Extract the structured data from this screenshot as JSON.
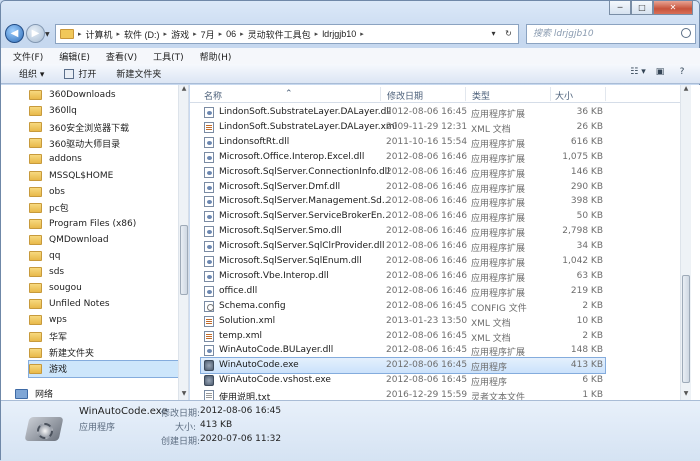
{
  "window": {
    "controls": {
      "minimize": "─",
      "maximize": "□",
      "close": "✕"
    }
  },
  "address": {
    "crumbs": [
      "计算机",
      "软件 (D:)",
      "游戏",
      "7月",
      "06",
      "灵动软件工具包",
      "ldrjgjb10"
    ],
    "dropdown": "▾",
    "refresh": "↻"
  },
  "search": {
    "placeholder": "搜索 ldrjgjb10"
  },
  "menu": [
    "文件(F)",
    "编辑(E)",
    "查看(V)",
    "工具(T)",
    "帮助(H)"
  ],
  "toolbar": {
    "organize": "组织 ▾",
    "open": "打开",
    "new_folder": "新建文件夹"
  },
  "sidebar": {
    "items": [
      {
        "label": "360Downloads"
      },
      {
        "label": "360llq"
      },
      {
        "label": "360安全浏览器下载"
      },
      {
        "label": "360驱动大师目录"
      },
      {
        "label": "addons"
      },
      {
        "label": "MSSQL$HOME"
      },
      {
        "label": "obs"
      },
      {
        "label": "pc包"
      },
      {
        "label": "Program Files (x86)"
      },
      {
        "label": "QMDownload"
      },
      {
        "label": "qq"
      },
      {
        "label": "sds"
      },
      {
        "label": "sougou"
      },
      {
        "label": "Unfiled Notes"
      },
      {
        "label": "wps"
      },
      {
        "label": "华军"
      },
      {
        "label": "新建文件夹"
      },
      {
        "label": "游戏"
      }
    ],
    "network": "网络"
  },
  "columns": {
    "name": "名称",
    "date": "修改日期",
    "type": "类型",
    "size": "大小"
  },
  "files": [
    {
      "name": "LindonSoft.SubstrateLayer.DALayer.dll",
      "date": "2012-08-06 16:45",
      "type": "应用程序扩展",
      "size": "36 KB",
      "icon": "dll"
    },
    {
      "name": "LindonSoft.SubstrateLayer.DALayer.xml",
      "date": "2009-11-29 12:31",
      "type": "XML 文档",
      "size": "26 KB",
      "icon": "xml"
    },
    {
      "name": "LindonsoftRt.dll",
      "date": "2011-10-16 15:54",
      "type": "应用程序扩展",
      "size": "616 KB",
      "icon": "dll"
    },
    {
      "name": "Microsoft.Office.Interop.Excel.dll",
      "date": "2012-08-06 16:46",
      "type": "应用程序扩展",
      "size": "1,075 KB",
      "icon": "dll"
    },
    {
      "name": "Microsoft.SqlServer.ConnectionInfo.dll",
      "date": "2012-08-06 16:46",
      "type": "应用程序扩展",
      "size": "146 KB",
      "icon": "dll"
    },
    {
      "name": "Microsoft.SqlServer.Dmf.dll",
      "date": "2012-08-06 16:46",
      "type": "应用程序扩展",
      "size": "290 KB",
      "icon": "dll"
    },
    {
      "name": "Microsoft.SqlServer.Management.Sd...",
      "date": "2012-08-06 16:46",
      "type": "应用程序扩展",
      "size": "398 KB",
      "icon": "dll"
    },
    {
      "name": "Microsoft.SqlServer.ServiceBrokerEn...",
      "date": "2012-08-06 16:46",
      "type": "应用程序扩展",
      "size": "50 KB",
      "icon": "dll"
    },
    {
      "name": "Microsoft.SqlServer.Smo.dll",
      "date": "2012-08-06 16:46",
      "type": "应用程序扩展",
      "size": "2,798 KB",
      "icon": "dll"
    },
    {
      "name": "Microsoft.SqlServer.SqlClrProvider.dll",
      "date": "2012-08-06 16:46",
      "type": "应用程序扩展",
      "size": "34 KB",
      "icon": "dll"
    },
    {
      "name": "Microsoft.SqlServer.SqlEnum.dll",
      "date": "2012-08-06 16:46",
      "type": "应用程序扩展",
      "size": "1,042 KB",
      "icon": "dll"
    },
    {
      "name": "Microsoft.Vbe.Interop.dll",
      "date": "2012-08-06 16:46",
      "type": "应用程序扩展",
      "size": "63 KB",
      "icon": "dll"
    },
    {
      "name": "office.dll",
      "date": "2012-08-06 16:46",
      "type": "应用程序扩展",
      "size": "219 KB",
      "icon": "dll"
    },
    {
      "name": "Schema.config",
      "date": "2012-08-06 16:45",
      "type": "CONFIG 文件",
      "size": "2 KB",
      "icon": "config"
    },
    {
      "name": "Solution.xml",
      "date": "2013-01-23 13:50",
      "type": "XML 文档",
      "size": "10 KB",
      "icon": "xml"
    },
    {
      "name": "temp.xml",
      "date": "2012-08-06 16:45",
      "type": "XML 文档",
      "size": "2 KB",
      "icon": "xml"
    },
    {
      "name": "WinAutoCode.BULayer.dll",
      "date": "2012-08-06 16:45",
      "type": "应用程序扩展",
      "size": "148 KB",
      "icon": "dll"
    },
    {
      "name": "WinAutoCode.exe",
      "date": "2012-08-06 16:45",
      "type": "应用程序",
      "size": "413 KB",
      "icon": "exe",
      "selected": true
    },
    {
      "name": "WinAutoCode.vshost.exe",
      "date": "2012-08-06 16:45",
      "type": "应用程序",
      "size": "6 KB",
      "icon": "exe"
    },
    {
      "name": "使用说明.txt",
      "date": "2016-12-29 15:59",
      "type": "灵者文本文件",
      "size": "1 KB",
      "icon": "txt"
    }
  ],
  "details": {
    "filename": "WinAutoCode.exe",
    "filetype": "应用程序",
    "modified_label": "修改日期:",
    "modified": "2012-08-06 16:45",
    "size_label": "大小:",
    "size": "413 KB",
    "created_label": "创建日期:",
    "created": "2020-07-06 11:32"
  }
}
